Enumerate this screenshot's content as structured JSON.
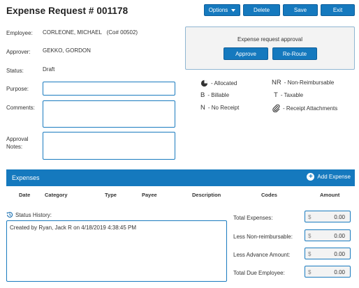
{
  "page": {
    "title": "Expense Request # 001178"
  },
  "toolbar": {
    "options": "Options",
    "delete": "Delete",
    "save": "Save",
    "exit": "Exit"
  },
  "fields": {
    "employee_label": "Employee:",
    "employee_value": "CORLEONE, MICHAEL",
    "employee_code": "(Co# 00502)",
    "approver_label": "Approver:",
    "approver_value": "GEKKO, GORDON",
    "status_label": "Status:",
    "status_value": "Draft",
    "purpose_label": "Purpose:",
    "comments_label": "Comments:",
    "approval_notes_label_1": "Approval",
    "approval_notes_label_2": "Notes:"
  },
  "approval": {
    "title": "Expense request approval",
    "approve": "Approve",
    "reroute": "Re-Route"
  },
  "legend": {
    "allocated": "- Allocated",
    "nr_sym": "NR",
    "nr": "- Non-Reimbursable",
    "b_sym": "B",
    "billable": "- Billable",
    "t_sym": "T",
    "taxable": "- Taxable",
    "n_sym": "N",
    "no_receipt": "- No Receipt",
    "attachments": "- Receipt Attachments"
  },
  "expenses": {
    "title": "Expenses",
    "add": "Add Expense",
    "columns": [
      "Date",
      "Category",
      "Type",
      "Payee",
      "Description",
      "Codes",
      "Amount"
    ]
  },
  "history": {
    "label": "Status History:",
    "entries": [
      "Created by Ryan, Jack R on 4/18/2019 4:38:45 PM"
    ]
  },
  "totals": {
    "currency": "$",
    "total_label": "Total Expenses:",
    "total_value": "0.00",
    "less_nr_label": "Less Non-reimbursable:",
    "less_nr_value": "0.00",
    "less_adv_label": "Less Advance Amount:",
    "less_adv_value": "0.00",
    "due_label": "Total Due Employee:",
    "due_value": "0.00"
  },
  "colors": {
    "accent": "#1579be",
    "border": "#1a7bbf",
    "panel_bg": "#f3f3f3"
  }
}
